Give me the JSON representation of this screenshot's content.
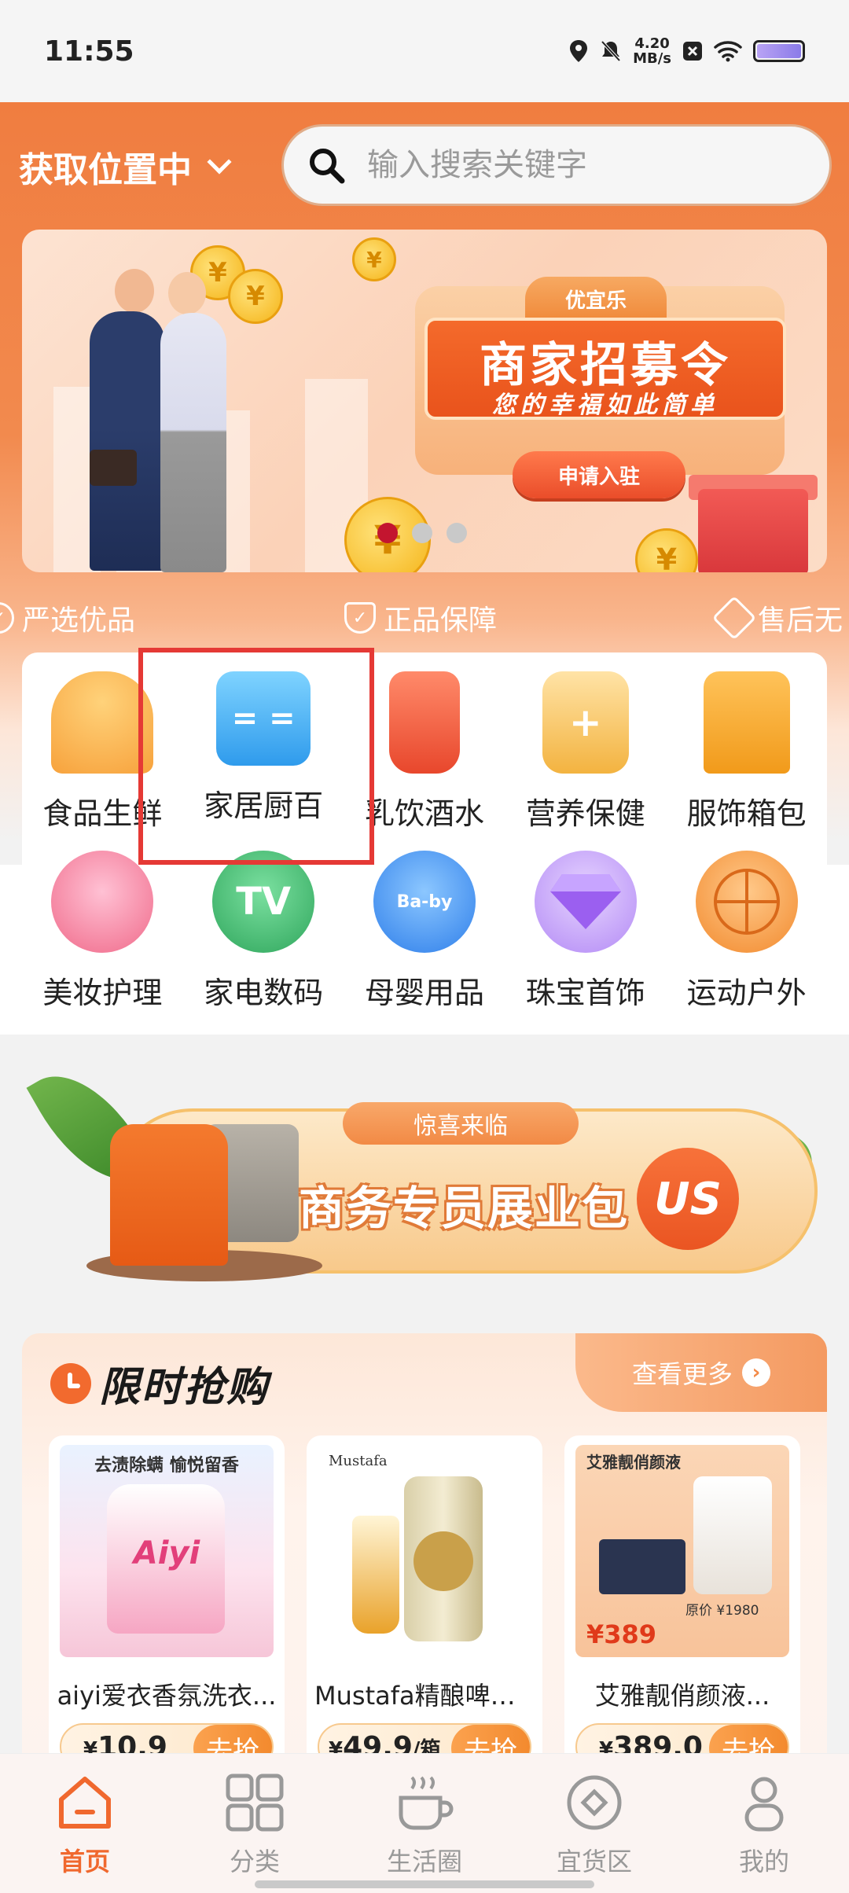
{
  "status_bar": {
    "time": "11:55",
    "speed_value": "4.20",
    "speed_unit": "MB/s"
  },
  "header": {
    "location_label": "获取位置中",
    "search_placeholder": "输入搜索关键字"
  },
  "banner": {
    "brand": "优宜乐",
    "title": "商家招募令",
    "subtitle": "您的幸福如此简单",
    "button": "申请入驻",
    "coin_symbol": "¥",
    "active_dot": 0,
    "dot_count": 3
  },
  "guarantees": [
    {
      "label": "严选优品",
      "icon": "check-circle-icon"
    },
    {
      "label": "正品保障",
      "icon": "shield-check-icon"
    },
    {
      "label": "售后无",
      "icon": "handshake-icon"
    }
  ],
  "categories": [
    {
      "label": "食品生鲜",
      "icon": "food-bowl-icon",
      "color": "#f7a23c"
    },
    {
      "label": "家居厨百",
      "icon": "bottles-icon",
      "color": "#39a8ef"
    },
    {
      "label": "乳饮酒水",
      "icon": "drink-cup-icon",
      "color": "#ef5d3f"
    },
    {
      "label": "营养保健",
      "icon": "supplement-jar-icon",
      "color": "#f3b340"
    },
    {
      "label": "服饰箱包",
      "icon": "jacket-icon",
      "color": "#f5a623"
    },
    {
      "label": "美妆护理",
      "icon": "lipstick-icon",
      "color": "#f06a8a"
    },
    {
      "label": "家电数码",
      "icon": "tv-icon",
      "color": "#3fb86a",
      "icon_text": "TV"
    },
    {
      "label": "母婴用品",
      "icon": "baby-bottle-icon",
      "color": "#3d8ff0",
      "icon_text": "Ba-by"
    },
    {
      "label": "珠宝首饰",
      "icon": "diamond-icon",
      "color": "#9b6ff0"
    },
    {
      "label": "运动户外",
      "icon": "basketball-icon",
      "color": "#f28a2e"
    }
  ],
  "promo": {
    "tag": "惊喜来临",
    "title": "商务专员展业包",
    "logo_text": "US"
  },
  "flash_sale": {
    "title": "限时抢购",
    "more_label": "查看更多",
    "products": [
      {
        "name": "aiyi爱衣香氛洗衣...",
        "price": "10.9",
        "unit": "",
        "currency": "¥",
        "cta": "去抢",
        "image_banner": "去渍除螨 愉悦留香",
        "image_brand": "Aiyi"
      },
      {
        "name": "Mustafa精酿啤酒 ...",
        "price": "49.9",
        "unit": "/箱",
        "currency": "¥",
        "cta": "去抢",
        "image_brand": "Mustafa"
      },
      {
        "name": "艾雅靓俏颜液...",
        "price": "389.0",
        "unit": "",
        "currency": "¥",
        "cta": "去抢",
        "image_banner": "艾雅靓俏颜液",
        "image_price_a": "原价 ¥1980",
        "image_price_b": "¥389"
      }
    ]
  },
  "bottom_nav": [
    {
      "label": "首页",
      "icon": "home-icon",
      "active": true
    },
    {
      "label": "分类",
      "icon": "grid-icon",
      "active": false
    },
    {
      "label": "生活圈",
      "icon": "coffee-cup-icon",
      "active": false
    },
    {
      "label": "宜货区",
      "icon": "diamond-outline-icon",
      "active": false
    },
    {
      "label": "我的",
      "icon": "person-icon",
      "active": false
    }
  ],
  "colors": {
    "brand_orange": "#f07d40",
    "highlight_red": "#e53935",
    "active_nav": "#f0682e"
  }
}
